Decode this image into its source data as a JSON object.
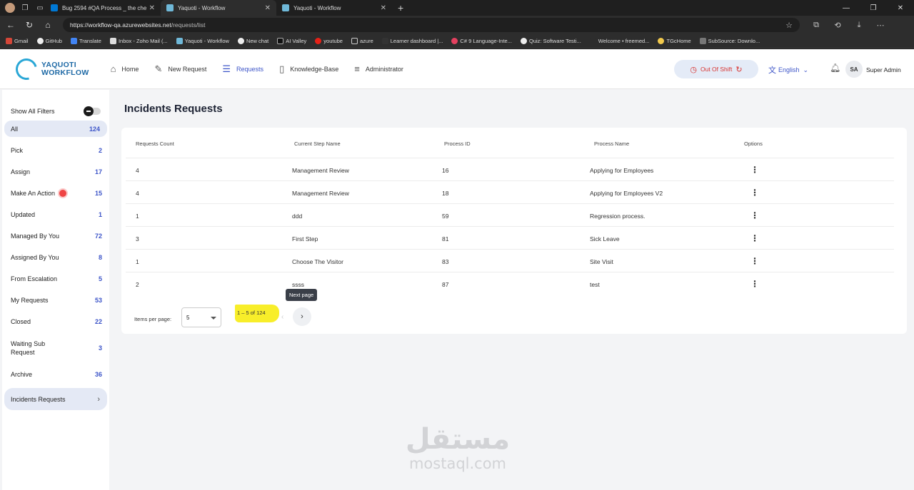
{
  "browser": {
    "tabs": [
      {
        "title": "Bug 2594 #QA Process _ the chec",
        "favicon": "azure-devops-icon",
        "active": false
      },
      {
        "title": "Yaquoti - Workflow",
        "favicon": "yaquoti-icon",
        "active": true
      },
      {
        "title": "Yaquoti - Workflow",
        "favicon": "yaquoti-icon",
        "active": false
      }
    ],
    "url_host": "https://workflow-qa.azurewebsites.net",
    "url_path": "/requests/list",
    "bookmarks": [
      "Gmail",
      "GitHub",
      "Translate",
      "Inbox - Zoho Mail (...",
      "Yaquoti - Workflow",
      "New chat",
      "AI Valley",
      "youtube",
      "azure",
      "Learner dashboard |...",
      "C# 9 Language-Inte...",
      "Quiz: Software Testi...",
      "Welcome • freemed...",
      "TGcHome",
      "SubSource: Downlo..."
    ]
  },
  "app": {
    "logo_line1": "YAQUOTI",
    "logo_line2": "WORKFLOW",
    "nav": [
      {
        "label": "Home",
        "icon": "home-icon"
      },
      {
        "label": "New Request",
        "icon": "edit-icon"
      },
      {
        "label": "Requests",
        "icon": "list-icon",
        "active": true
      },
      {
        "label": "Knowledge-Base",
        "icon": "book-icon"
      },
      {
        "label": "Administrator",
        "icon": "sliders-icon"
      }
    ],
    "shift_label": "Out Of Shift",
    "language": "English",
    "user_initials": "SA",
    "user_name": "Super Admin",
    "accent_color": "#3c54c8"
  },
  "sidebar": {
    "filter_toggle_label": "Show All Filters",
    "items": [
      {
        "label": "All",
        "count": "124"
      },
      {
        "label": "Pick",
        "count": "2"
      },
      {
        "label": "Assign",
        "count": "17"
      },
      {
        "label": "Make An Action",
        "count": "15"
      },
      {
        "label": "Updated",
        "count": "1"
      },
      {
        "label": "Managed By You",
        "count": "72"
      },
      {
        "label": "Assigned By You",
        "count": "8"
      },
      {
        "label": "From Escalation",
        "count": "5"
      },
      {
        "label": "My Requests",
        "count": "53"
      },
      {
        "label": "Closed",
        "count": "22"
      },
      {
        "label": "Waiting Sub Request",
        "count": "3"
      },
      {
        "label": "Archive",
        "count": "36"
      },
      {
        "label": "Incidents Requests",
        "count": ""
      }
    ]
  },
  "main": {
    "title": "Incidents Requests",
    "columns": [
      "Requests Count",
      "Current Step Name",
      "Process ID",
      "Process Name",
      "Options"
    ],
    "rows": [
      {
        "count": "4",
        "step": "Management Review",
        "pid": "16",
        "pname": "Applying for Employees"
      },
      {
        "count": "4",
        "step": "Management Review",
        "pid": "18",
        "pname": "Applying for Employees V2"
      },
      {
        "count": "1",
        "step": "ddd",
        "pid": "59",
        "pname": "Regression process."
      },
      {
        "count": "3",
        "step": "First Step",
        "pid": "81",
        "pname": "Sick Leave"
      },
      {
        "count": "1",
        "step": "Choose The Visitor",
        "pid": "83",
        "pname": "Site Visit"
      },
      {
        "count": "2",
        "step": "ssss",
        "pid": "87",
        "pname": "test"
      }
    ],
    "pager": {
      "items_per_page_label": "Items per page:",
      "items_per_page_value": "5",
      "range": "1 – 5 of 124",
      "tooltip": "Next page"
    }
  },
  "watermark": {
    "arabic": "مستقل",
    "latin": "mostaql.com"
  }
}
